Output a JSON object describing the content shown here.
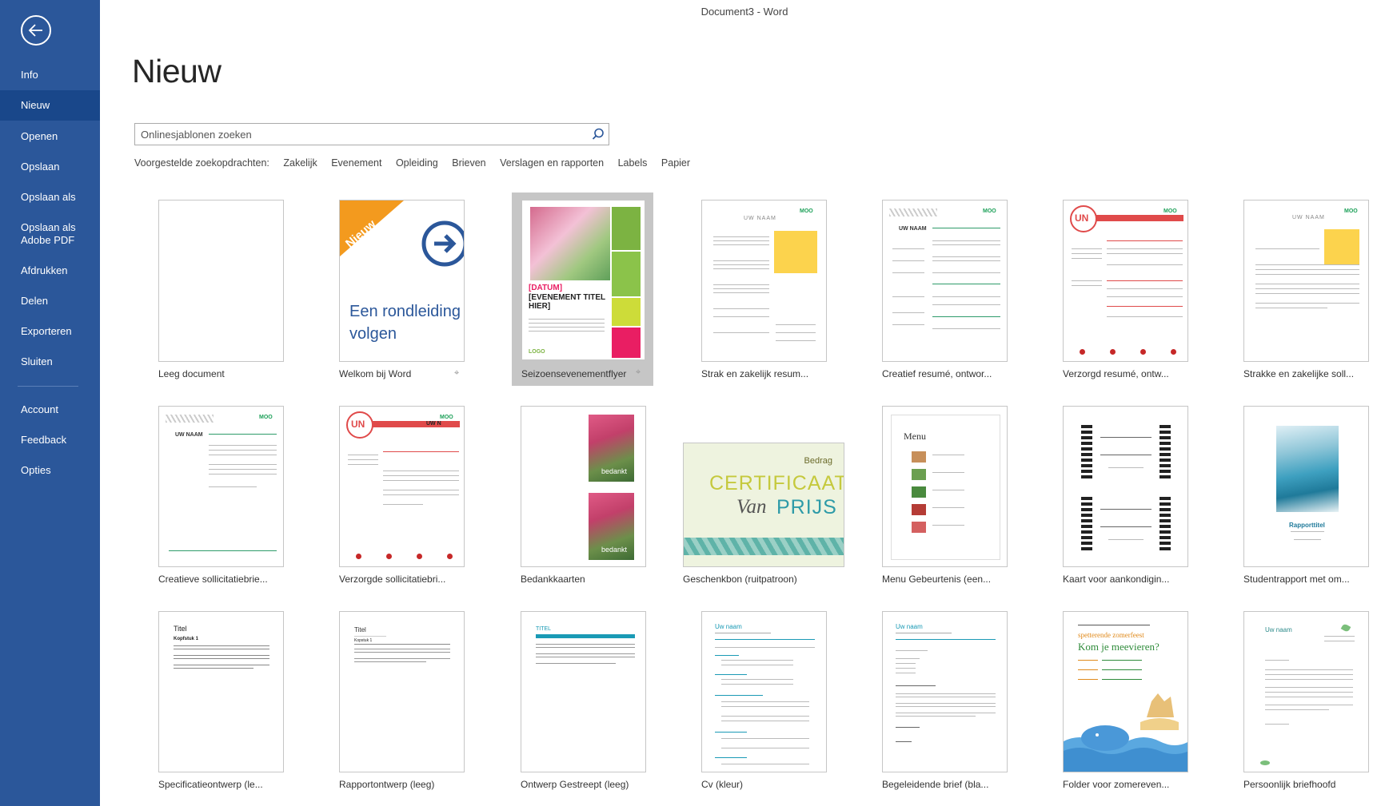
{
  "window": {
    "title": "Document3  -  Word"
  },
  "sidebar": {
    "items": [
      {
        "label": "Info"
      },
      {
        "label": "Nieuw"
      },
      {
        "label": "Openen"
      },
      {
        "label": "Opslaan"
      },
      {
        "label": "Opslaan als"
      },
      {
        "label": "Opslaan als\nAdobe PDF"
      },
      {
        "label": "Afdrukken"
      },
      {
        "label": "Delen"
      },
      {
        "label": "Exporteren"
      },
      {
        "label": "Sluiten"
      },
      {
        "label": "Account"
      },
      {
        "label": "Feedback"
      },
      {
        "label": "Opties"
      }
    ],
    "active_index": 1,
    "accent_color": "#2b579a"
  },
  "main": {
    "title": "Nieuw",
    "search": {
      "placeholder": "Onlinesjablonen zoeken",
      "value": ""
    },
    "suggestions": {
      "label": "Voorgestelde zoekopdrachten:",
      "items": [
        "Zakelijk",
        "Evenement",
        "Opleiding",
        "Brieven",
        "Verslagen en rapporten",
        "Labels",
        "Papier"
      ]
    },
    "templates": [
      {
        "label": "Leeg document"
      },
      {
        "label": "Welkom bij Word",
        "badge": "Nieuw",
        "thumb_text_1": "Een rondleiding",
        "thumb_text_2": "volgen"
      },
      {
        "label": "Seizoensevenementflyer",
        "thumb_text_1": "[DATUM]",
        "thumb_text_2": "[EVENEMENT TITEL HIER]",
        "thumb_logo": "LOGO"
      },
      {
        "label": "Strak en zakelijk resum...",
        "thumb_text_1": "UW NAAM"
      },
      {
        "label": "Creatief resumé, ontwor...",
        "thumb_text_1": "UW NAAM"
      },
      {
        "label": "Verzorgd resumé, ontw...",
        "thumb_text_1": "UN"
      },
      {
        "label": "Strakke en zakelijke soll...",
        "thumb_text_1": "UW NAAM"
      },
      {
        "label": "Creatieve sollicitatiebrie...",
        "thumb_text_1": "UW NAAM"
      },
      {
        "label": "Verzorgde sollicitatiebri...",
        "thumb_text_1": "UN",
        "thumb_text_2": "UW N"
      },
      {
        "label": "Bedankkaarten",
        "thumb_text_1": "bedankt"
      },
      {
        "label": "Geschenkbon (ruitpatroon)",
        "thumb_text_1": "Bedrag",
        "thumb_text_2": "CERTIFICAAT",
        "thumb_text_3": "Van",
        "thumb_text_4": "PRIJS"
      },
      {
        "label": "Menu Gebeurtenis (een...",
        "thumb_text_1": "Menu"
      },
      {
        "label": "Kaart voor aankondigin..."
      },
      {
        "label": "Studentrapport met om...",
        "thumb_text_1": "Rapporttitel"
      },
      {
        "label": "Specificatieontwerp (le...",
        "thumb_text_1": "Titel",
        "thumb_text_2": "Kopfstuk 1"
      },
      {
        "label": "Rapportontwerp (leeg)",
        "thumb_text_1": "Titel",
        "thumb_text_2": "Kopstuk 1"
      },
      {
        "label": "Ontwerp Gestreept (leeg)",
        "thumb_text_1": "TITEL"
      },
      {
        "label": "Cv (kleur)",
        "thumb_text_1": "Uw naam"
      },
      {
        "label": "Begeleidende brief (bla...",
        "thumb_text_1": "Uw naam"
      },
      {
        "label": "Folder voor zomereven...",
        "thumb_text_1": "spetterende zomerfeest",
        "thumb_text_2": "Kom je meevieren?"
      },
      {
        "label": "Persoonlijk briefhoofd",
        "thumb_text_1": "Uw naam"
      }
    ],
    "moo_label": "MOO"
  }
}
